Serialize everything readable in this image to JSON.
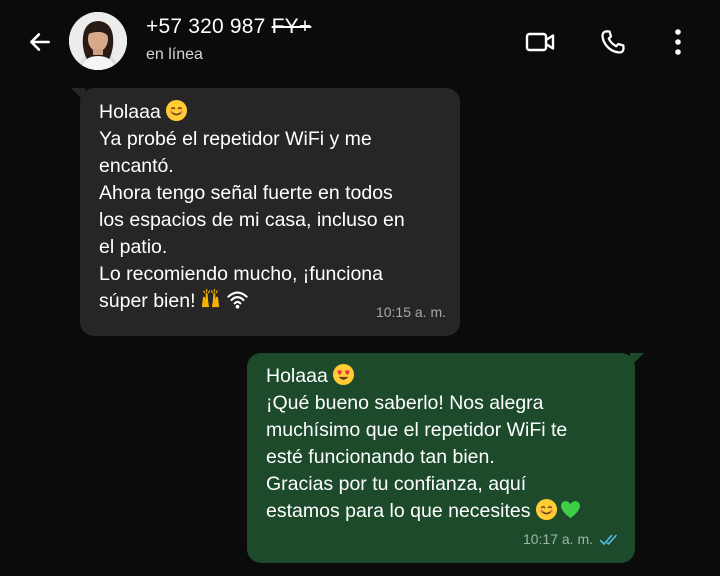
{
  "header": {
    "phone_visible": "+57 320 987",
    "phone_masked": "FY+",
    "status": "en línea"
  },
  "messages": [
    {
      "direction": "incoming",
      "lines": [
        "Holaaa",
        "Ya probé el repetidor WiFi y me",
        "encantó.",
        "Ahora tengo señal fuerte en todos",
        "los espacios de mi casa, incluso en",
        "el patio.",
        "Lo recomiendo mucho, ¡funciona",
        "súper bien!"
      ],
      "time": "10:15 a. m.",
      "emojis": [
        "smiling-face-emoji",
        "raising-hands-emoji",
        "wifi-icon"
      ]
    },
    {
      "direction": "outgoing",
      "lines": [
        "Holaaa",
        "¡Qué bueno saberlo! Nos alegra",
        "muchísimo que el repetidor WiFi te",
        "esté funcionando tan bien.",
        "Gracias por tu confianza, aquí",
        "estamos para lo que necesites"
      ],
      "time": "10:17 a. m.",
      "status": "read",
      "emojis": [
        "heart-eyes-emoji",
        "smiling-face-emoji",
        "green-heart-emoji"
      ]
    }
  ],
  "colors": {
    "background": "#0b0b0b",
    "incoming_bubble": "#262626",
    "outgoing_bubble": "#1c4a2b",
    "read_ticks": "#53bdeb"
  },
  "icons": {
    "back": "arrow-left-icon",
    "video": "video-camera-icon",
    "call": "phone-icon",
    "menu": "kebab-menu-icon"
  }
}
